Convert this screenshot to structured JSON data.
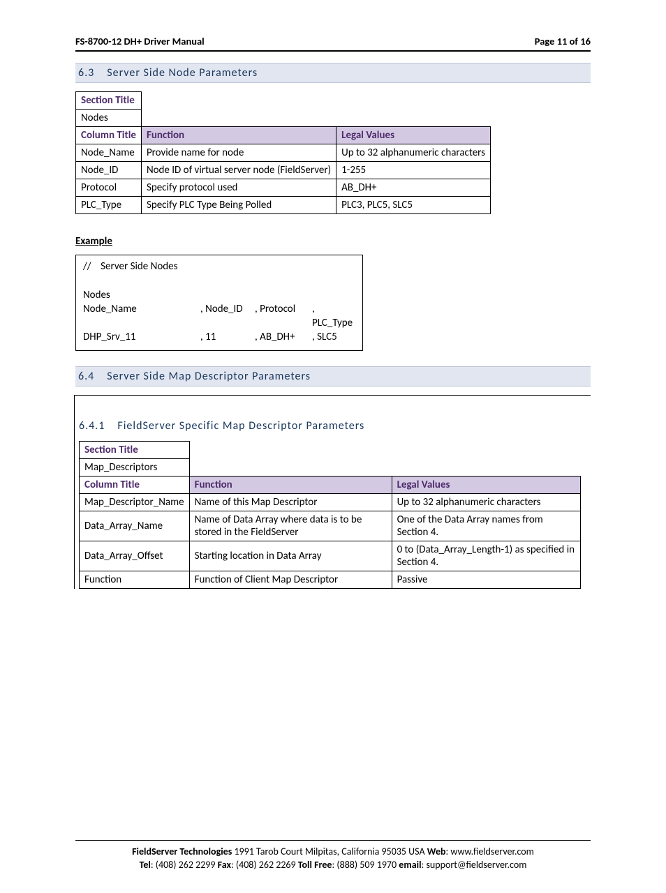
{
  "header": {
    "left": "FS-8700-12 DH+ Driver Manual",
    "right": "Page 11 of 16"
  },
  "section63": {
    "num": "6.3",
    "title": "Server Side Node Parameters",
    "table": {
      "sectionTitleLabel": "Section Title",
      "sectionTitleValue": "Nodes",
      "columnTitleLabel": "Column Title",
      "funcHeader": "Function",
      "legalHeader": "Legal Values",
      "rows": [
        {
          "c": "Node_Name",
          "f": "Provide name for node",
          "l": "Up to 32 alphanumeric characters"
        },
        {
          "c": "Node_ID",
          "f": "Node ID of virtual server node (FieldServer)",
          "l": "1-255"
        },
        {
          "c": "Protocol",
          "f": "Specify protocol used",
          "l": "AB_DH+"
        },
        {
          "c": "PLC_Type",
          "f": "Specify PLC Type Being Polled",
          "l": "PLC3, PLC5, SLC5"
        }
      ]
    },
    "exampleLabel": "Example",
    "example": {
      "line1": "//    Server Side Nodes",
      "blank": " ",
      "nodes": "Nodes",
      "hdr": {
        "a": "Node_Name",
        "b": ", Node_ID",
        "c": ", Protocol",
        "d": ", PLC_Type"
      },
      "row": {
        "a": "DHP_Srv_11",
        "b": ", 11",
        "c": ", AB_DH+",
        "d": ", SLC5"
      }
    }
  },
  "section64": {
    "num": "6.4",
    "title": "Server Side Map Descriptor Parameters"
  },
  "section641": {
    "num": "6.4.1",
    "title": "FieldServer Specific Map Descriptor Parameters",
    "table": {
      "sectionTitleLabel": "Section Title",
      "sectionTitleValue": "Map_Descriptors",
      "columnTitleLabel": "Column Title",
      "funcHeader": "Function",
      "legalHeader": "Legal Values",
      "rows": [
        {
          "c": "Map_Descriptor_Name",
          "f": "Name of this Map Descriptor",
          "l": "Up to 32 alphanumeric characters"
        },
        {
          "c": "Data_Array_Name",
          "f": "Name of Data Array where data is to be stored in the FieldServer",
          "l": "One of the Data Array names from Section 4."
        },
        {
          "c": "Data_Array_Offset",
          "f": "Starting location in Data Array",
          "l": "0 to (Data_Array_Length-1) as specified in Section 4."
        },
        {
          "c": "Function",
          "f": "Function of Client Map Descriptor",
          "l": "Passive"
        }
      ]
    }
  },
  "footer": {
    "line1a": "FieldServer Technologies",
    "line1b": " 1991 Tarob Court Milpitas, California 95035 USA   ",
    "webLabel": "Web",
    "webVal": ": www.fieldserver.com",
    "telLabel": "Tel",
    "telVal": ": (408) 262 2299   ",
    "faxLabel": "Fax",
    "faxVal": ": (408) 262 2269   ",
    "tollLabel": "Toll Free",
    "tollVal": ": (888) 509 1970   ",
    "emailLabel": "email",
    "emailVal": ": support@fieldserver.com"
  }
}
